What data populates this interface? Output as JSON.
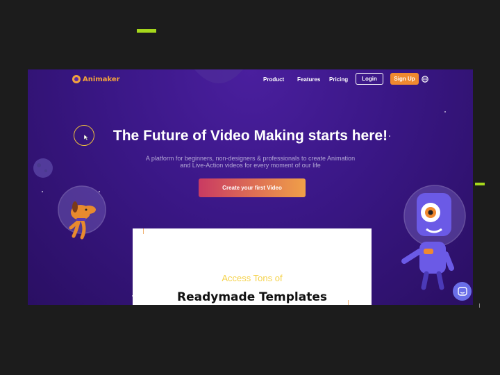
{
  "brand": {
    "name": "Animaker"
  },
  "nav": {
    "links": [
      "Product",
      "Features",
      "Pricing"
    ],
    "login_label": "Login",
    "signup_label": "Sign Up"
  },
  "hero": {
    "title": "The Future of Video Making starts here!",
    "subtitle_line1": "A platform for beginners, non-designers & professionals to create Animation",
    "subtitle_line2": "and Live-Action videos for every moment of our life",
    "cta_label": "Create your first Video"
  },
  "templates_panel": {
    "eyebrow": "Access Tons of",
    "title": "Readymade Templates"
  },
  "icons": [
    "globe-icon",
    "chat-icon",
    "cursor-arrow-icon",
    "dog-astronaut-illustration",
    "robot-astronaut-illustration",
    "planet-illustration"
  ],
  "colors": {
    "accent": "#a6d81c",
    "brand_orange": "#f3a33c",
    "signup": "#f0892f",
    "hero_bg": "#3a1786",
    "chat": "#6a6ee8"
  }
}
